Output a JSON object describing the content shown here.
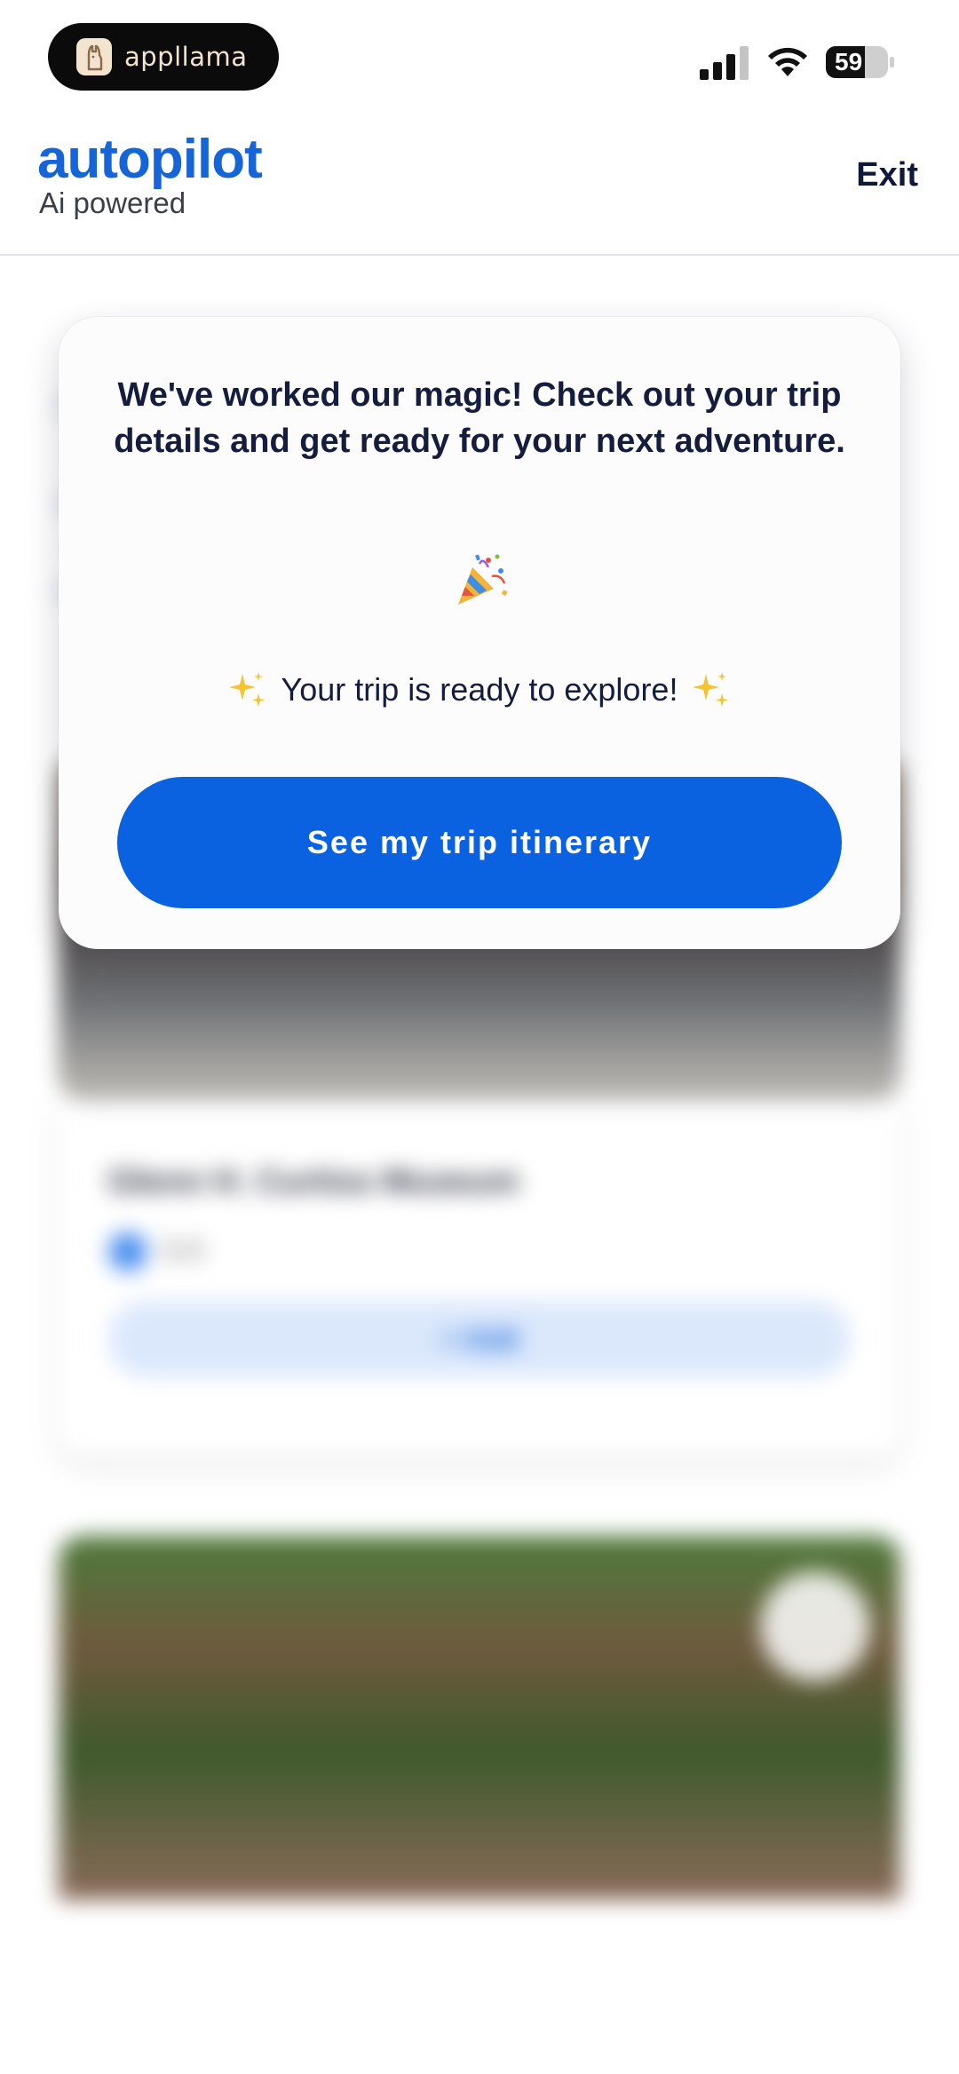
{
  "status_bar": {
    "app_name": "appllama",
    "battery_level": "59",
    "icons": [
      "llama-icon",
      "cellular-signal-icon",
      "wifi-icon",
      "battery-icon"
    ]
  },
  "header": {
    "logo": "autopilot",
    "logo_subtitle": "Ai powered",
    "exit_label": "Exit"
  },
  "background": {
    "card_title": "Glenn H. Curtiss Museum",
    "rating": "5.0",
    "add_label": "+ Add"
  },
  "modal": {
    "message": "We've worked our magic! Check out your trip details and get ready for your next adventure.",
    "celebration_icon": "party-popper-icon",
    "ready_text": "Your trip is ready to explore!",
    "cta_label": "See my trip itinerary"
  },
  "colors": {
    "brand_blue": "#1565d8",
    "cta_blue": "#0a62e0",
    "text_dark": "#141d3d"
  }
}
